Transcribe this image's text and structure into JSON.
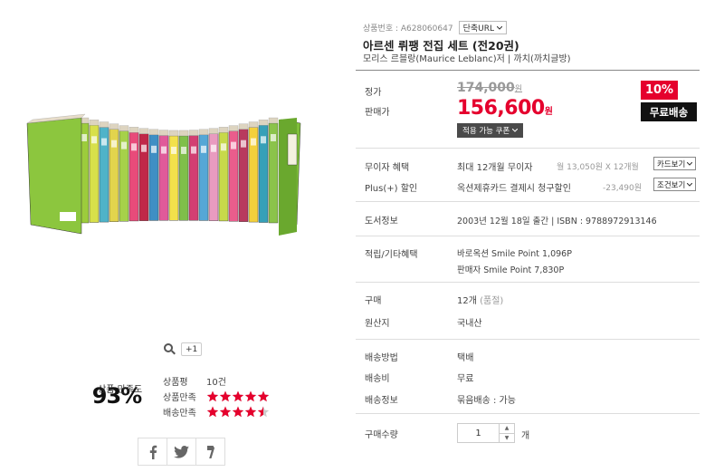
{
  "product_image": {
    "alt": "아르센 뤼팽 전집 세트 book set"
  },
  "zoom": {
    "icon": "magnifier-icon",
    "plus_one_label": "+1"
  },
  "satisfaction": {
    "label": "상품 만족도",
    "percent": "93%",
    "ratings": [
      {
        "label": "상품평",
        "value": "10건"
      },
      {
        "label": "상품만족",
        "stars": 5.0
      },
      {
        "label": "배송만족",
        "stars": 4.5
      }
    ]
  },
  "share": [
    {
      "icon": "facebook-icon"
    },
    {
      "icon": "twitter-icon"
    },
    {
      "icon": "share-link-icon"
    }
  ],
  "product": {
    "code_label": "상품번호 : A628060647",
    "url_button": "단축URL",
    "title": "아르센 뤼팽 전집 세트 (전20권)",
    "author": "모리스 르블랑(Maurice Leblanc)저 | 까치(까치글방)"
  },
  "price": {
    "list_label": "정가",
    "list_value": "174,000",
    "won": "원",
    "sale_label": "판매가",
    "sale_value": "156,600",
    "discount": "10%",
    "free_shipping": "무료배송",
    "coupon_button": "적용 가능 쿠폰"
  },
  "benefits": {
    "interest_free_label": "무이자 혜택",
    "interest_free_value": "최대 12개월 무이자",
    "interest_free_note": "월 13,050원 X 12개월",
    "card_button": "카드보기",
    "plus_label": "Plus(+) 할인",
    "plus_value": "옥션제휴카드 결제시 청구할인",
    "plus_amount": "-23,490원",
    "condition_button": "조건보기"
  },
  "book_info": {
    "label": "도서정보",
    "value": "2003년 12월 18일 출간  |  ISBN : 9788972913146"
  },
  "points": {
    "label": "적립/기타혜택",
    "line1": "바로옥션 Smile Point 1,096P",
    "line2": "판매자 Smile Point 7,830P"
  },
  "purchase": {
    "label": "구매",
    "value": "12개",
    "value_note": "(품절)",
    "origin_label": "원산지",
    "origin_value": "국내산"
  },
  "shipping": {
    "method_label": "배송방법",
    "method_value": "택배",
    "fee_label": "배송비",
    "fee_value": "무료",
    "info_label": "배송정보",
    "info_value": "묶음배송 : 가능"
  },
  "quantity": {
    "label": "구매수량",
    "value": "1",
    "unit": "개"
  }
}
